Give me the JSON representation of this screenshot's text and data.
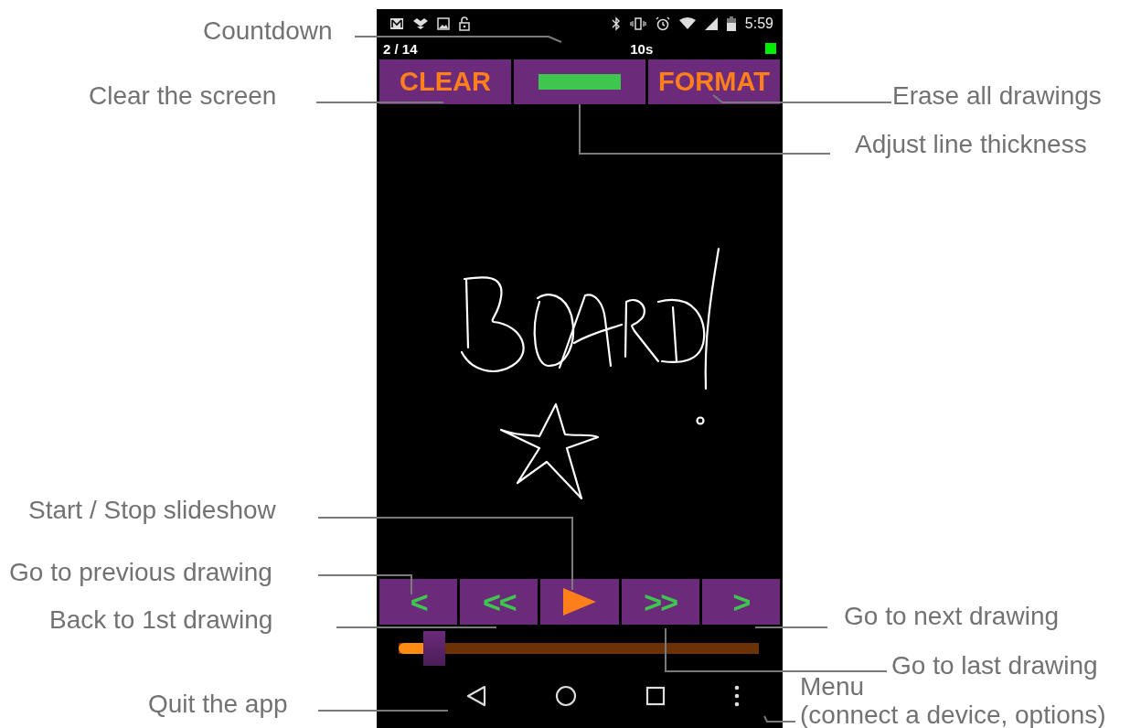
{
  "status_bar": {
    "time": "5:59"
  },
  "header": {
    "counter": "2 / 14",
    "countdown": "10s",
    "connected": true
  },
  "top_buttons": [
    {
      "kind": "text",
      "label": "CLEAR"
    },
    {
      "kind": "thickness"
    },
    {
      "kind": "text",
      "label": "FORMAT"
    }
  ],
  "bottom_buttons": [
    {
      "kind": "text",
      "label": "<"
    },
    {
      "kind": "text",
      "label": "<<"
    },
    {
      "kind": "play"
    },
    {
      "kind": "text",
      "label": ">>"
    },
    {
      "kind": "text",
      "label": ">"
    }
  ],
  "slider": {
    "level": 0.1
  },
  "annotations": [
    {
      "text": "Countdown"
    },
    {
      "text": "Clear the screen"
    },
    {
      "text": "Erase all drawings"
    },
    {
      "text": "Adjust line thickness"
    },
    {
      "text": "Start / Stop slideshow"
    },
    {
      "text": "Go to previous drawing"
    },
    {
      "text": "Back to 1st drawing"
    },
    {
      "text": "Go to next drawing"
    },
    {
      "text": "Go to last drawing"
    },
    {
      "text": "Quit the app"
    },
    {
      "text": "Menu"
    },
    {
      "text": "(connect a device, options)"
    }
  ]
}
